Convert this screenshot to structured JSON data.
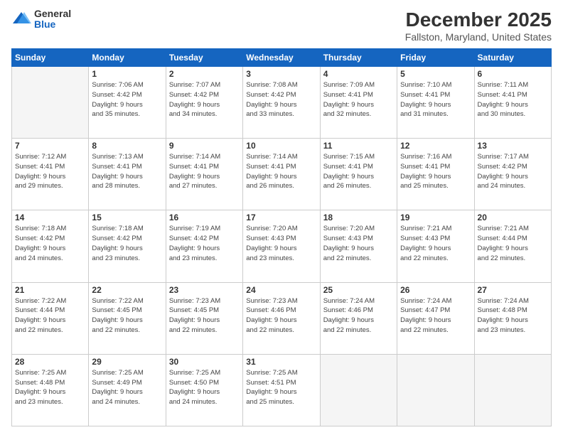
{
  "logo": {
    "general": "General",
    "blue": "Blue"
  },
  "title": "December 2025",
  "location": "Fallston, Maryland, United States",
  "days_header": [
    "Sunday",
    "Monday",
    "Tuesday",
    "Wednesday",
    "Thursday",
    "Friday",
    "Saturday"
  ],
  "weeks": [
    [
      {
        "day": "",
        "sunrise": "",
        "sunset": "",
        "daylight": ""
      },
      {
        "day": "1",
        "sunrise": "7:06 AM",
        "sunset": "4:42 PM",
        "daylight": "9 hours and 35 minutes."
      },
      {
        "day": "2",
        "sunrise": "7:07 AM",
        "sunset": "4:42 PM",
        "daylight": "9 hours and 34 minutes."
      },
      {
        "day": "3",
        "sunrise": "7:08 AM",
        "sunset": "4:42 PM",
        "daylight": "9 hours and 33 minutes."
      },
      {
        "day": "4",
        "sunrise": "7:09 AM",
        "sunset": "4:41 PM",
        "daylight": "9 hours and 32 minutes."
      },
      {
        "day": "5",
        "sunrise": "7:10 AM",
        "sunset": "4:41 PM",
        "daylight": "9 hours and 31 minutes."
      },
      {
        "day": "6",
        "sunrise": "7:11 AM",
        "sunset": "4:41 PM",
        "daylight": "9 hours and 30 minutes."
      }
    ],
    [
      {
        "day": "7",
        "sunrise": "7:12 AM",
        "sunset": "4:41 PM",
        "daylight": "9 hours and 29 minutes."
      },
      {
        "day": "8",
        "sunrise": "7:13 AM",
        "sunset": "4:41 PM",
        "daylight": "9 hours and 28 minutes."
      },
      {
        "day": "9",
        "sunrise": "7:14 AM",
        "sunset": "4:41 PM",
        "daylight": "9 hours and 27 minutes."
      },
      {
        "day": "10",
        "sunrise": "7:14 AM",
        "sunset": "4:41 PM",
        "daylight": "9 hours and 26 minutes."
      },
      {
        "day": "11",
        "sunrise": "7:15 AM",
        "sunset": "4:41 PM",
        "daylight": "9 hours and 26 minutes."
      },
      {
        "day": "12",
        "sunrise": "7:16 AM",
        "sunset": "4:41 PM",
        "daylight": "9 hours and 25 minutes."
      },
      {
        "day": "13",
        "sunrise": "7:17 AM",
        "sunset": "4:42 PM",
        "daylight": "9 hours and 24 minutes."
      }
    ],
    [
      {
        "day": "14",
        "sunrise": "7:18 AM",
        "sunset": "4:42 PM",
        "daylight": "9 hours and 24 minutes."
      },
      {
        "day": "15",
        "sunrise": "7:18 AM",
        "sunset": "4:42 PM",
        "daylight": "9 hours and 23 minutes."
      },
      {
        "day": "16",
        "sunrise": "7:19 AM",
        "sunset": "4:42 PM",
        "daylight": "9 hours and 23 minutes."
      },
      {
        "day": "17",
        "sunrise": "7:20 AM",
        "sunset": "4:43 PM",
        "daylight": "9 hours and 23 minutes."
      },
      {
        "day": "18",
        "sunrise": "7:20 AM",
        "sunset": "4:43 PM",
        "daylight": "9 hours and 22 minutes."
      },
      {
        "day": "19",
        "sunrise": "7:21 AM",
        "sunset": "4:43 PM",
        "daylight": "9 hours and 22 minutes."
      },
      {
        "day": "20",
        "sunrise": "7:21 AM",
        "sunset": "4:44 PM",
        "daylight": "9 hours and 22 minutes."
      }
    ],
    [
      {
        "day": "21",
        "sunrise": "7:22 AM",
        "sunset": "4:44 PM",
        "daylight": "9 hours and 22 minutes."
      },
      {
        "day": "22",
        "sunrise": "7:22 AM",
        "sunset": "4:45 PM",
        "daylight": "9 hours and 22 minutes."
      },
      {
        "day": "23",
        "sunrise": "7:23 AM",
        "sunset": "4:45 PM",
        "daylight": "9 hours and 22 minutes."
      },
      {
        "day": "24",
        "sunrise": "7:23 AM",
        "sunset": "4:46 PM",
        "daylight": "9 hours and 22 minutes."
      },
      {
        "day": "25",
        "sunrise": "7:24 AM",
        "sunset": "4:46 PM",
        "daylight": "9 hours and 22 minutes."
      },
      {
        "day": "26",
        "sunrise": "7:24 AM",
        "sunset": "4:47 PM",
        "daylight": "9 hours and 22 minutes."
      },
      {
        "day": "27",
        "sunrise": "7:24 AM",
        "sunset": "4:48 PM",
        "daylight": "9 hours and 23 minutes."
      }
    ],
    [
      {
        "day": "28",
        "sunrise": "7:25 AM",
        "sunset": "4:48 PM",
        "daylight": "9 hours and 23 minutes."
      },
      {
        "day": "29",
        "sunrise": "7:25 AM",
        "sunset": "4:49 PM",
        "daylight": "9 hours and 24 minutes."
      },
      {
        "day": "30",
        "sunrise": "7:25 AM",
        "sunset": "4:50 PM",
        "daylight": "9 hours and 24 minutes."
      },
      {
        "day": "31",
        "sunrise": "7:25 AM",
        "sunset": "4:51 PM",
        "daylight": "9 hours and 25 minutes."
      },
      {
        "day": "",
        "sunrise": "",
        "sunset": "",
        "daylight": ""
      },
      {
        "day": "",
        "sunrise": "",
        "sunset": "",
        "daylight": ""
      },
      {
        "day": "",
        "sunrise": "",
        "sunset": "",
        "daylight": ""
      }
    ]
  ]
}
